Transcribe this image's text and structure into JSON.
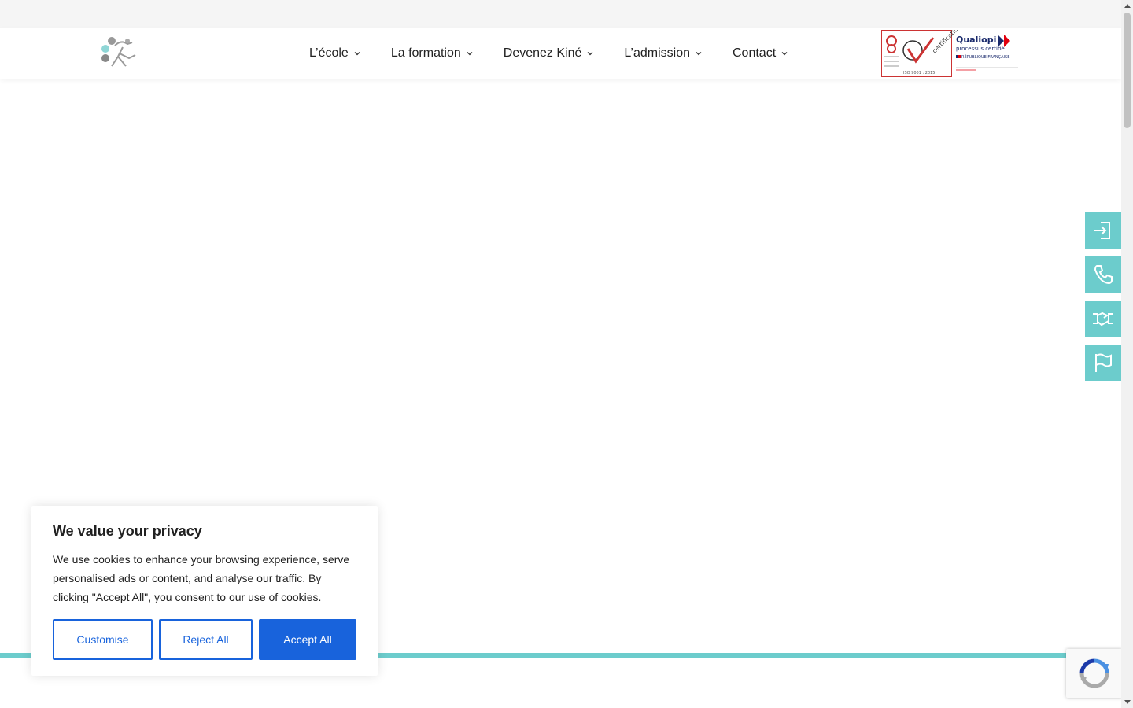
{
  "nav": {
    "items": [
      {
        "label": "L’école"
      },
      {
        "label": "La formation"
      },
      {
        "label": "Devenez Kiné"
      },
      {
        "label": "L’admission"
      },
      {
        "label": "Contact"
      }
    ]
  },
  "certifications": {
    "afnor_mark": "AB certification",
    "qualiopi_title": "Qualiopi",
    "qualiopi_subtitle": "processus certifié",
    "qualiopi_country": "RÉPUBLIQUE FRANÇAISE"
  },
  "side_actions": {
    "icons": [
      "login-icon",
      "phone-icon",
      "handshake-icon",
      "flag-icon"
    ]
  },
  "cookie_banner": {
    "title": "We value your privacy",
    "text": "We use cookies to enhance your browsing experience, serve personalised ads or content, and analyse our traffic. By clicking \"Accept All\", you consent to our use of cookies.",
    "customise_label": "Customise",
    "reject_label": "Reject All",
    "accept_label": "Accept All"
  },
  "colors": {
    "accent_teal": "#6ccccc",
    "cookie_blue": "#1863dc"
  }
}
